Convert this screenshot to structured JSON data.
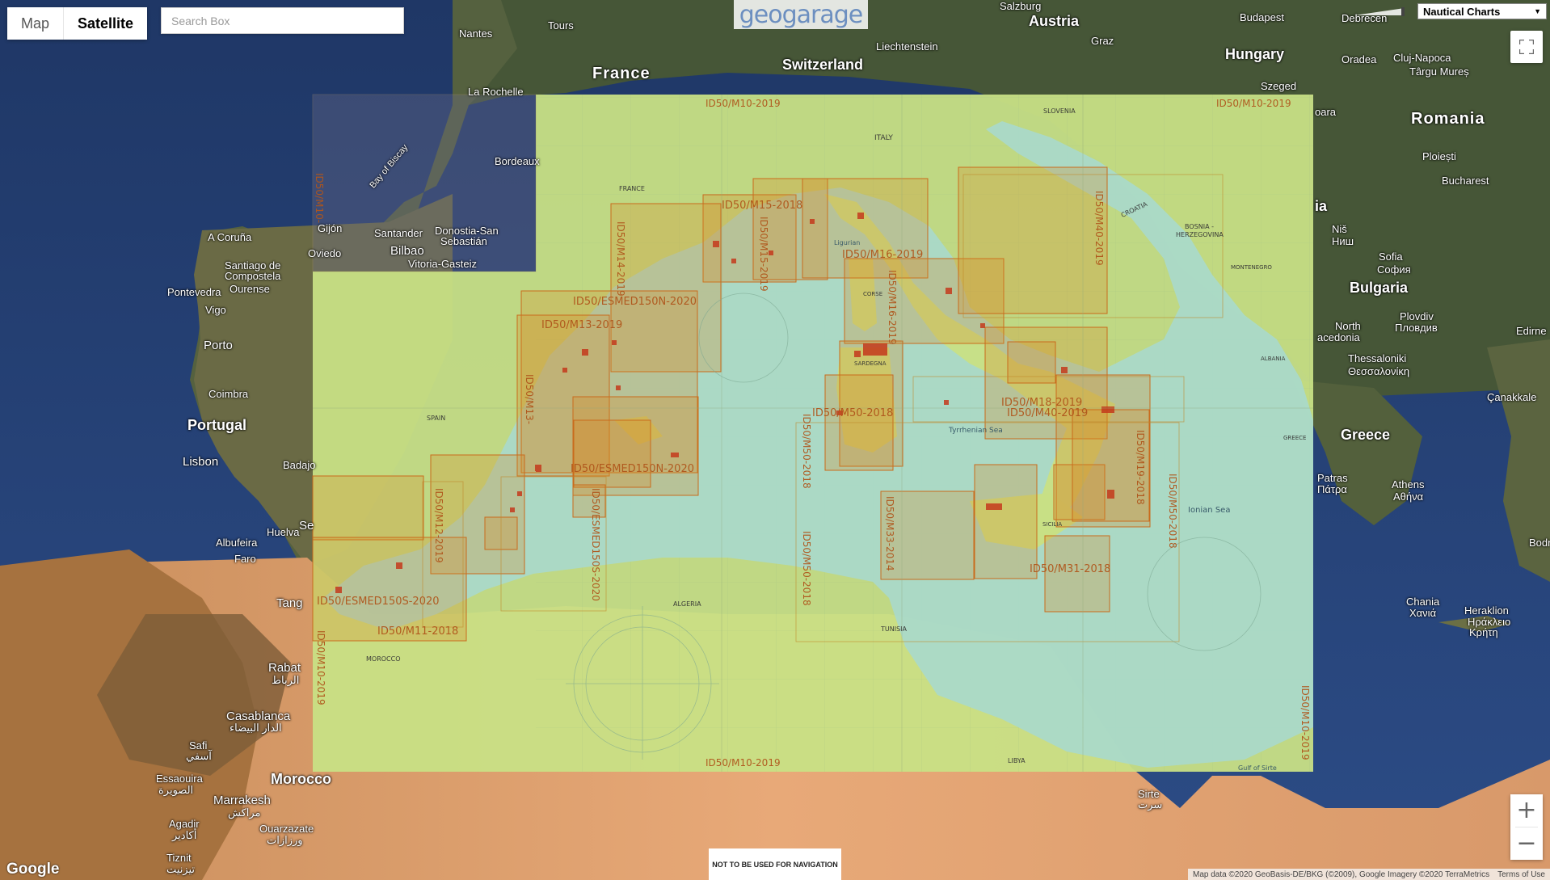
{
  "map_type": {
    "map_label": "Map",
    "satellite_label": "Satellite",
    "selected": "Satellite"
  },
  "search": {
    "placeholder": "Search Box"
  },
  "logo": {
    "text": "geogarage"
  },
  "layer_select": {
    "value": "Nautical Charts"
  },
  "nav_warning": "NOT TO BE USED FOR NAVIGATION",
  "google_logo": "Google",
  "attribution": {
    "text": "Map data ©2020 GeoBasis-DE/BKG (©2009), Google Imagery ©2020 TerraMetrics",
    "terms": "Terms of Use"
  },
  "places": {
    "france": "France",
    "austria": "Austria",
    "hungary": "Hungary",
    "switzerland": "Switzerland",
    "liechtenstein": "Liechtenstein",
    "romania": "Romania",
    "bulgaria": "Bulgaria",
    "greece": "Greece",
    "portugal": "Portugal",
    "morocco": "Morocco",
    "ia": "ia",
    "salzburg": "Salzburg",
    "budapest": "Budapest",
    "debrecen": "Debrecen",
    "graz": "Graz",
    "szeged": "Szeged",
    "oradea": "Oradea",
    "cluj": "Cluj-Napoca",
    "targu": "Târgu Mureș",
    "soara": "oara",
    "ploiesti": "Ploiești",
    "bucharest": "Bucharest",
    "sofia": "Sofia",
    "sofia_cyr": "София",
    "plovdiv": "Plovdiv",
    "plovdiv_cyr": "Пловдив",
    "nish": "Niš",
    "nish_cyr": "Ниш",
    "macedonia": "North",
    "macedonia2": "acedonia",
    "thessaloniki": "Thessaloniki",
    "thessaloniki_gr": "Θεσσαλονίκη",
    "edirne": "Edirne",
    "canakkale": "Çanakkale",
    "patras": "Patras",
    "patras_gr": "Πάτρα",
    "athens": "Athens",
    "athens_gr": "Αθήνα",
    "chania": "Chania",
    "chania_gr": "Χανιά",
    "heraklion": "Heraklion",
    "heraklion_gr": "Ηράκλειο",
    "kriti": "Κρήτη",
    "bodr": "Bodr",
    "nantes": "Nantes",
    "tours": "Tours",
    "la_rochelle": "La Rochelle",
    "bordeaux": "Bordeaux",
    "bay_biscay": "Bay of Biscay",
    "a_coruna": "A Coruña",
    "santiago": "Santiago de",
    "compostela": "Compostela",
    "ourense": "Ourense",
    "pontevedra": "Pontevedra",
    "vigo": "Vigo",
    "gijon": "Gijón",
    "oviedo": "Oviedo",
    "santander": "Santander",
    "bilbao": "Bilbao",
    "donostia": "Donostia-San",
    "sebastian": "Sebastián",
    "vitoria": "Vitoria-Gasteiz",
    "porto": "Porto",
    "coimbra": "Coimbra",
    "lisbon": "Lisbon",
    "badajoz": "Badajo",
    "huelva": "Huelva",
    "albufeira": "Albufeira",
    "faro": "Faro",
    "se": "Se",
    "tang": "Tang",
    "rabat": "Rabat",
    "rabat_ar": "الرباط",
    "casablanca": "Casablanca",
    "casablanca_ar": "الدار البيضاء",
    "safi": "Safi",
    "safi_ar": "آسفي",
    "essaouira": "Essaouira",
    "essaouira_ar": "الصويرة",
    "marrakesh": "Marrakesh",
    "marrakesh_ar": "مراكش",
    "agadir": "Agadir",
    "agadir_ar": "أكادير",
    "ouarzazate": "Ouarzazate",
    "ouarzazate_ar": "ورزازات",
    "tiznit": "Tiznit",
    "tiznit_ar": "تيزنيت",
    "sirte": "Sirte",
    "sirte_ar": "سرت"
  },
  "chart_labels": {
    "m10_top_left": "ID50/M10-2019",
    "m10_top_right": "ID50/M10-2019",
    "m10_bottom": "ID50/M10-2019",
    "m10_left": "ID50/M10-2019",
    "m10_right": "ID50/M10-2019",
    "m10_far_left": "ID50/M10-",
    "m15": "ID50/M15-2018",
    "m14": "ID50/M14-2019",
    "m15_v": "ID50/M15-2019",
    "m16": "ID50/M16-2019",
    "m16_v": "ID50/M16-2019",
    "m40_v": "ID50/M40-2019",
    "esmed150n_top": "ID50/ESMED150N-2020",
    "m13": "ID50/M13-2019",
    "m13_v": "ID50/M13-",
    "esmed150n_mid": "ID50/ESMED150N-2020",
    "m18": "ID50/M18-2019",
    "m40": "ID50/M40-2019",
    "m50_a": "ID50/M50-2018",
    "m50_b": "ID50/M50-2018",
    "m50_right": "ID50/M50-2018",
    "m19": "ID50/M19-2018",
    "m12": "ID50/M12-2019",
    "esmed150s_v": "ID50/ESMED150S-2020",
    "esmed150s": "ID50/ESMED150S-2020",
    "m11": "ID50/M11-2018",
    "m31": "ID50/M31-2018",
    "m33": "ID50/M33-2014",
    "m14_v2": "ID50/M14-2019"
  },
  "chart_text": {
    "italy": "ITALY",
    "france": "FRANCE",
    "spain": "SPAIN",
    "algeria": "ALGERIA",
    "tunisia": "TUNISIA",
    "libya": "LIBYA",
    "morocco": "MOROCCO",
    "slovenia": "SLOVENIA",
    "croatia": "CROATIA",
    "bosnia": "BOSNIA -",
    "herzegovina": "HERZEGOVINA",
    "montenegro": "MONTENEGRO",
    "albania": "ALBANIA",
    "greece": "GREECE",
    "ionian": "Ionian   Sea",
    "tyrrhenian": "Tyrrhenian Sea",
    "gulf_sirte": "Gulf of Sirte",
    "sicilia": "SICILIA",
    "sardegna": "SARDEGNA",
    "corse": "CORSE",
    "ligurian": "Ligurian"
  }
}
